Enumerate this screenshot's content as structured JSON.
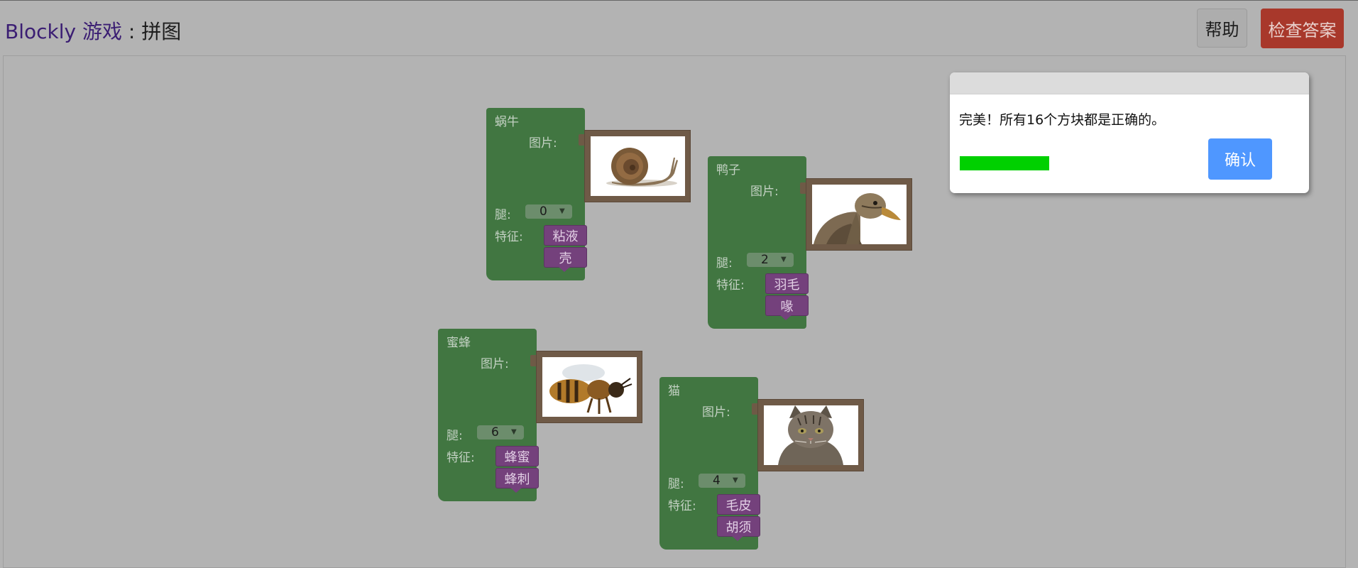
{
  "header": {
    "title_link": "Blockly 游戏",
    "title_separator": " : ",
    "title_page": "拼图",
    "help_label": "帮助",
    "check_label": "检查答案"
  },
  "labels": {
    "picture": "图片:",
    "legs": "腿:",
    "traits": "特征:"
  },
  "blocks": [
    {
      "name": "蜗牛",
      "legs": "0",
      "traits": [
        "粘液",
        "壳"
      ],
      "picture": "snail"
    },
    {
      "name": "鸭子",
      "legs": "2",
      "traits": [
        "羽毛",
        "喙"
      ],
      "picture": "duck"
    },
    {
      "name": "蜜蜂",
      "legs": "6",
      "traits": [
        "蜂蜜",
        "蜂刺"
      ],
      "picture": "bee"
    },
    {
      "name": "猫",
      "legs": "4",
      "traits": [
        "毛皮",
        "胡须"
      ],
      "picture": "cat"
    }
  ],
  "dialog": {
    "message": "完美！所有16个方块都是正确的。",
    "ok_label": "确认",
    "progress": 1.0
  },
  "colors": {
    "background": "#b3b3b3",
    "block": "#417641",
    "trait": "#74417c",
    "check_button": "#a8382b",
    "ok_button": "#4f97ff",
    "progress": "#00d000"
  }
}
